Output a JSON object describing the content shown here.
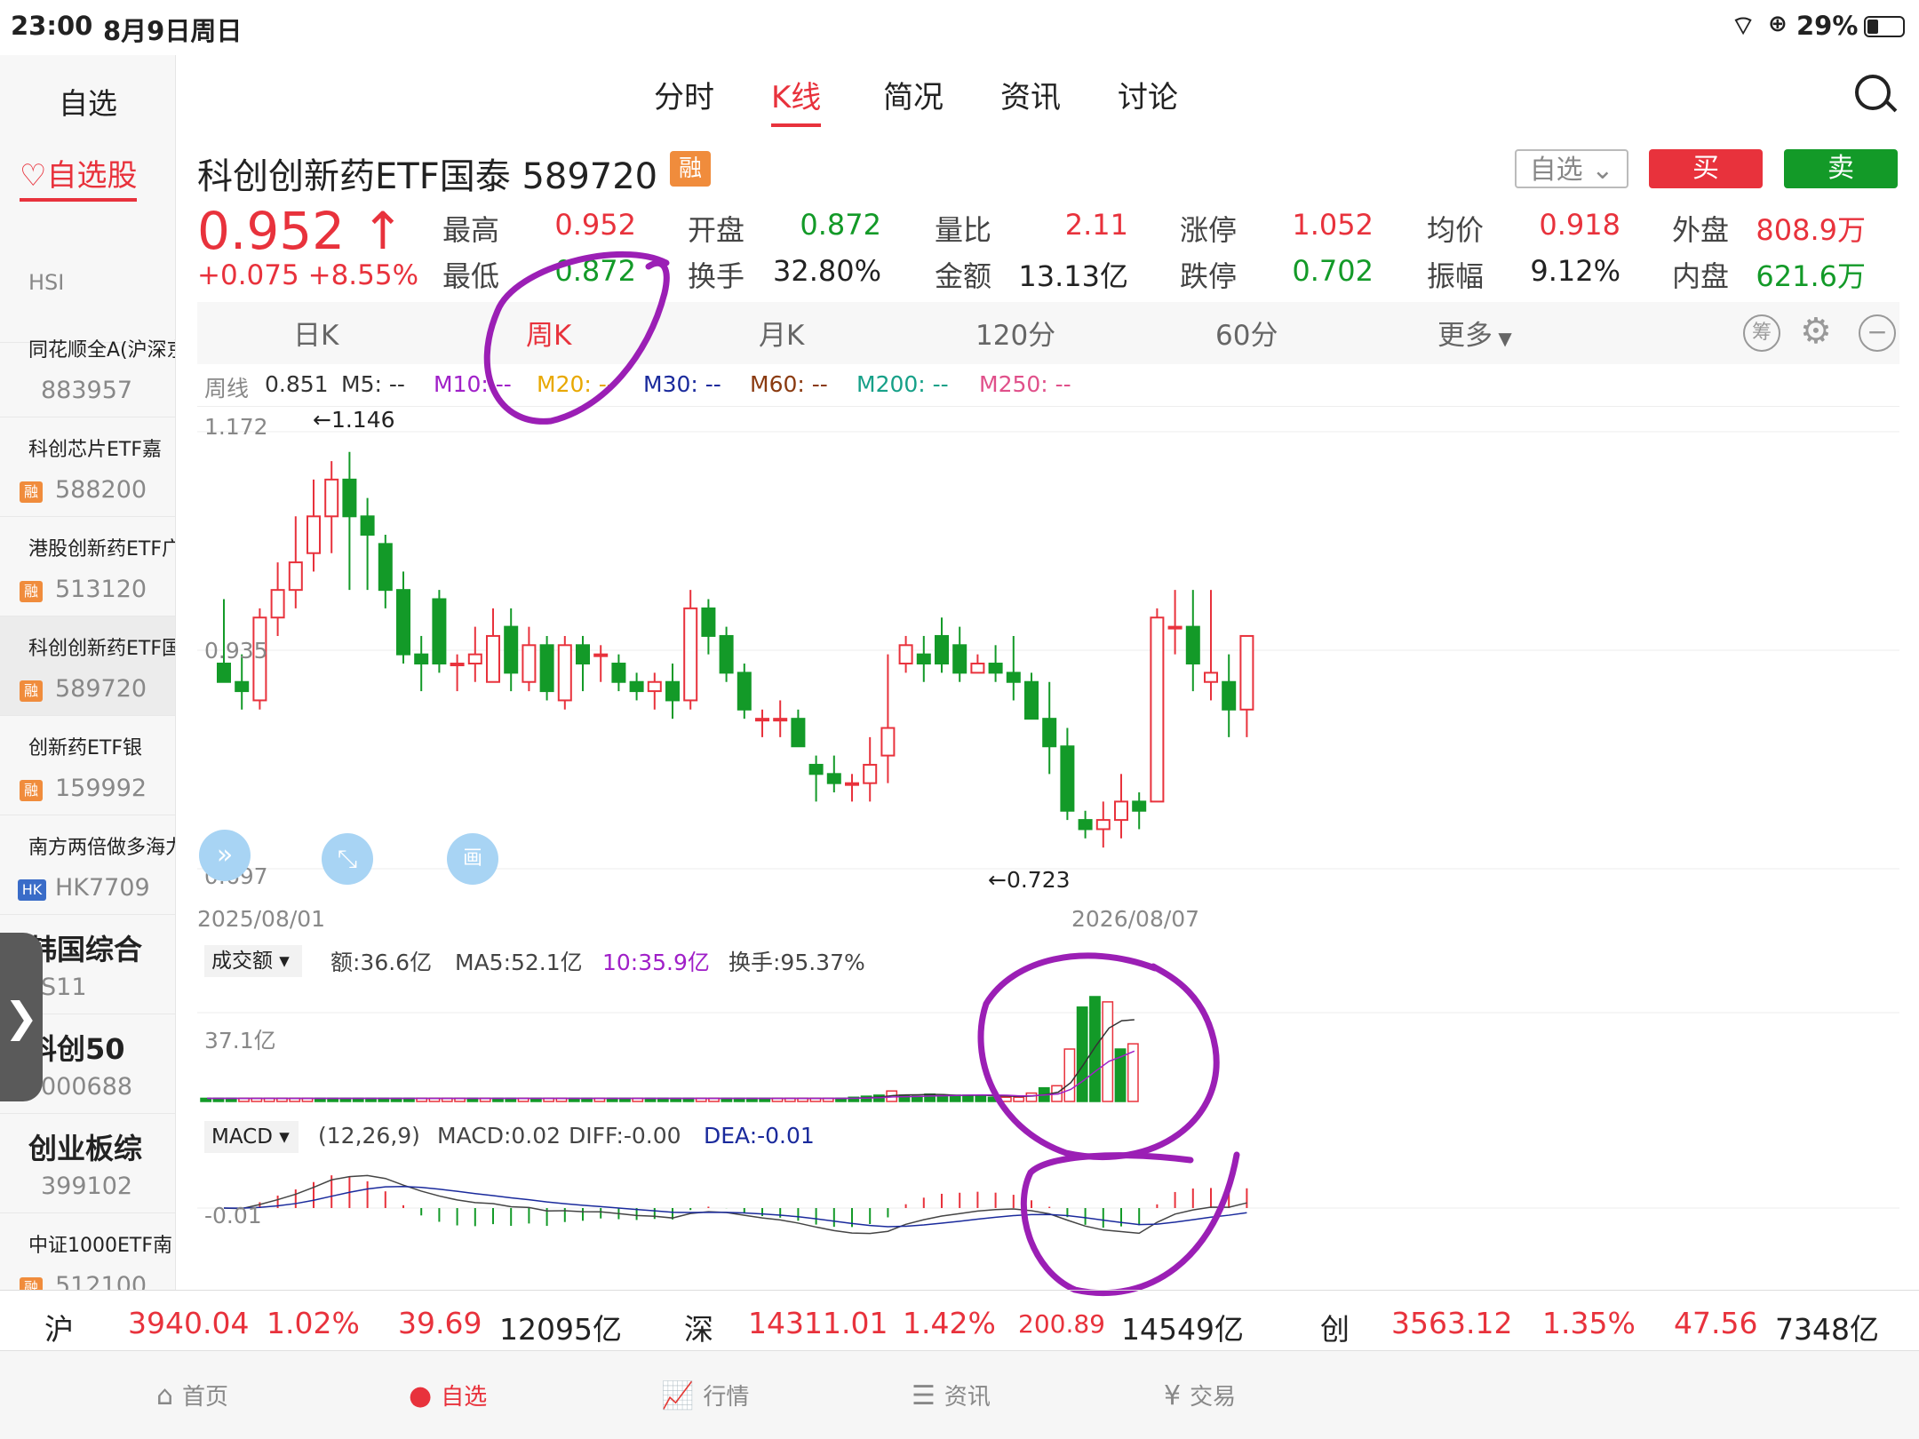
{
  "status": {
    "time": "23:00",
    "date": "8月9日周日",
    "battery": "29%"
  },
  "sidebar": {
    "title": "自选",
    "tab": "自选股",
    "items": [
      {
        "name": "HSI",
        "code": "",
        "badge": ""
      },
      {
        "name": "同花顺全A(沪深京",
        "code": "883957",
        "badge": ""
      },
      {
        "name": "科创芯片ETF嘉",
        "code": "588200",
        "badge": "融"
      },
      {
        "name": "港股创新药ETF广",
        "code": "513120",
        "badge": "融"
      },
      {
        "name": "科创创新药ETF国",
        "code": "589720",
        "badge": "融"
      },
      {
        "name": "创新药ETF银",
        "code": "159992",
        "badge": "融"
      },
      {
        "name": "南方两倍做多海力",
        "code": "HK7709",
        "badge": "HK"
      },
      {
        "name": "韩国综合",
        "code": "S11",
        "badge": ""
      },
      {
        "name": "科创50",
        "code": "000688",
        "badge": ""
      },
      {
        "name": "创业板综",
        "code": "399102",
        "badge": ""
      },
      {
        "name": "中证1000ETF南",
        "code": "512100",
        "badge": "融"
      }
    ]
  },
  "tabs": [
    "分时",
    "K线",
    "简况",
    "资讯",
    "讨论"
  ],
  "active_tab": "K线",
  "stock": {
    "name": "科创创新药ETF国泰",
    "code": "589720",
    "badge": "融",
    "price": "0.952",
    "arrow": "↑",
    "change": "+0.075",
    "change_pct": "+8.55%",
    "watch_btn": "自选",
    "buy_btn": "买",
    "sell_btn": "卖",
    "stats": [
      {
        "label": "最高",
        "value": "0.952",
        "color": "red"
      },
      {
        "label": "开盘",
        "value": "0.872",
        "color": "green"
      },
      {
        "label": "量比",
        "value": "2.11",
        "color": "red"
      },
      {
        "label": "涨停",
        "value": "1.052",
        "color": "red"
      },
      {
        "label": "均价",
        "value": "0.918",
        "color": "red"
      },
      {
        "label": "外盘",
        "value": "808.9万",
        "color": "red"
      },
      {
        "label": "最低",
        "value": "0.872",
        "color": "green"
      },
      {
        "label": "换手",
        "value": "32.80%",
        "color": "black"
      },
      {
        "label": "金额",
        "value": "13.13亿",
        "color": "black"
      },
      {
        "label": "跌停",
        "value": "0.702",
        "color": "green"
      },
      {
        "label": "振幅",
        "value": "9.12%",
        "color": "black"
      },
      {
        "label": "内盘",
        "value": "621.6万",
        "color": "green"
      }
    ]
  },
  "ktabs": [
    "日K",
    "周K",
    "月K",
    "120分",
    "60分",
    "更多"
  ],
  "active_ktab": "周K",
  "ma_line": {
    "prefix": "周线",
    "close": "0.851",
    "items": [
      {
        "label": "M5: --",
        "color": "#333"
      },
      {
        "label": "M10: --",
        "color": "#a020c8"
      },
      {
        "label": "M20: --",
        "color": "#e8a800"
      },
      {
        "label": "M30: --",
        "color": "#1a2a9c"
      },
      {
        "label": "M60: --",
        "color": "#8a3a10"
      },
      {
        "label": "M200: --",
        "color": "#16a088"
      },
      {
        "label": "M250: --",
        "color": "#e0508a"
      }
    ]
  },
  "chart_data": {
    "type": "candlestick",
    "period": "weekly",
    "y_ticks": [
      "1.172",
      "0.935",
      "0.697"
    ],
    "ylim": [
      0.697,
      1.172
    ],
    "x_labels": [
      "2025/08/01",
      "2026/08/07"
    ],
    "high_label": "←1.146",
    "low_label": "←0.723",
    "candles": [
      [
        0.92,
        0.9,
        0.99,
        0.9
      ],
      [
        0.9,
        0.89,
        0.93,
        0.87
      ],
      [
        0.88,
        0.97,
        0.98,
        0.87
      ],
      [
        0.97,
        1.0,
        1.03,
        0.95
      ],
      [
        1.0,
        1.03,
        1.08,
        0.98
      ],
      [
        1.04,
        1.08,
        1.12,
        1.02
      ],
      [
        1.08,
        1.12,
        1.14,
        1.04
      ],
      [
        1.12,
        1.08,
        1.15,
        1.0
      ],
      [
        1.08,
        1.06,
        1.1,
        1.0
      ],
      [
        1.05,
        1.0,
        1.06,
        0.98
      ],
      [
        1.0,
        0.93,
        1.02,
        0.92
      ],
      [
        0.93,
        0.92,
        0.95,
        0.89
      ],
      [
        0.99,
        0.92,
        1.0,
        0.91
      ],
      [
        0.92,
        0.92,
        0.93,
        0.89
      ],
      [
        0.92,
        0.93,
        0.96,
        0.9
      ],
      [
        0.9,
        0.95,
        0.98,
        0.9
      ],
      [
        0.96,
        0.91,
        0.98,
        0.89
      ],
      [
        0.9,
        0.94,
        0.96,
        0.89
      ],
      [
        0.94,
        0.89,
        0.95,
        0.88
      ],
      [
        0.88,
        0.94,
        0.95,
        0.87
      ],
      [
        0.94,
        0.92,
        0.95,
        0.89
      ],
      [
        0.93,
        0.93,
        0.94,
        0.9
      ],
      [
        0.92,
        0.9,
        0.93,
        0.89
      ],
      [
        0.9,
        0.89,
        0.91,
        0.88
      ],
      [
        0.89,
        0.9,
        0.91,
        0.87
      ],
      [
        0.9,
        0.88,
        0.92,
        0.86
      ],
      [
        0.88,
        0.98,
        1.0,
        0.87
      ],
      [
        0.98,
        0.95,
        0.99,
        0.93
      ],
      [
        0.95,
        0.91,
        0.96,
        0.9
      ],
      [
        0.91,
        0.87,
        0.92,
        0.86
      ],
      [
        0.86,
        0.86,
        0.87,
        0.84
      ],
      [
        0.86,
        0.86,
        0.88,
        0.84
      ],
      [
        0.86,
        0.83,
        0.87,
        0.83
      ],
      [
        0.81,
        0.8,
        0.82,
        0.77
      ],
      [
        0.8,
        0.79,
        0.82,
        0.78
      ],
      [
        0.79,
        0.79,
        0.8,
        0.77
      ],
      [
        0.79,
        0.81,
        0.84,
        0.77
      ],
      [
        0.82,
        0.85,
        0.93,
        0.79
      ],
      [
        0.92,
        0.94,
        0.95,
        0.91
      ],
      [
        0.93,
        0.92,
        0.95,
        0.9
      ],
      [
        0.95,
        0.92,
        0.97,
        0.91
      ],
      [
        0.94,
        0.91,
        0.96,
        0.9
      ],
      [
        0.91,
        0.92,
        0.93,
        0.91
      ],
      [
        0.92,
        0.91,
        0.94,
        0.9
      ],
      [
        0.91,
        0.9,
        0.95,
        0.88
      ],
      [
        0.9,
        0.86,
        0.91,
        0.86
      ],
      [
        0.86,
        0.83,
        0.9,
        0.8
      ],
      [
        0.83,
        0.76,
        0.85,
        0.75
      ],
      [
        0.75,
        0.74,
        0.76,
        0.73
      ],
      [
        0.74,
        0.75,
        0.77,
        0.72
      ],
      [
        0.75,
        0.77,
        0.8,
        0.73
      ],
      [
        0.77,
        0.76,
        0.78,
        0.74
      ],
      [
        0.77,
        0.97,
        0.98,
        0.77
      ],
      [
        0.96,
        0.96,
        1.0,
        0.93
      ],
      [
        0.96,
        0.92,
        1.0,
        0.89
      ],
      [
        0.9,
        0.91,
        1.0,
        0.88
      ],
      [
        0.9,
        0.87,
        0.93,
        0.84
      ],
      [
        0.87,
        0.95,
        0.95,
        0.84
      ]
    ],
    "volume": {
      "label": "成交额",
      "amount": "额:36.6亿",
      "ma5": "MA5:52.1亿",
      "ma10": "10:35.9亿",
      "turnover": "换手:95.37%",
      "y_tick": "37.1亿",
      "values": [
        3,
        3,
        3,
        3,
        3,
        3,
        3,
        3,
        3,
        3,
        3,
        3,
        3,
        3,
        3,
        3,
        3,
        3,
        3,
        3,
        3,
        3,
        3,
        3,
        3,
        3,
        3,
        3,
        3,
        3,
        3,
        3,
        3,
        3,
        3,
        3,
        3,
        3,
        3,
        3,
        3,
        3,
        3,
        3,
        3,
        3,
        3,
        3,
        3,
        3,
        3,
        4,
        5,
        6,
        10,
        6,
        5,
        7,
        5,
        6,
        6,
        6,
        4,
        4,
        4,
        8,
        13,
        15,
        50,
        90,
        100,
        95,
        50,
        55
      ]
    },
    "macd": {
      "label": "MACD",
      "params": "(12,26,9)",
      "macd": "MACD:0.02",
      "diff": "DIFF:-0.00",
      "dea": "DEA:-0.01",
      "y_tick": "-0.01"
    }
  },
  "bottom_indices": [
    {
      "name": "沪",
      "value": "3940.04",
      "pct": "1.02%",
      "chg": "39.69",
      "amt": "12095亿"
    },
    {
      "name": "深",
      "value": "14311.01",
      "pct": "1.42%",
      "chg": "200.89",
      "amt": "14549亿"
    },
    {
      "name": "创",
      "value": "3563.12",
      "pct": "1.35%",
      "chg": "47.56",
      "amt": "7348亿"
    }
  ],
  "nav": [
    "首页",
    "自选",
    "行情",
    "资讯",
    "交易"
  ],
  "active_nav": "自选",
  "colors": {
    "up": "#e8323c",
    "down": "#139a28",
    "accent": "#e8323c",
    "annotation": "#9b1fb5"
  }
}
